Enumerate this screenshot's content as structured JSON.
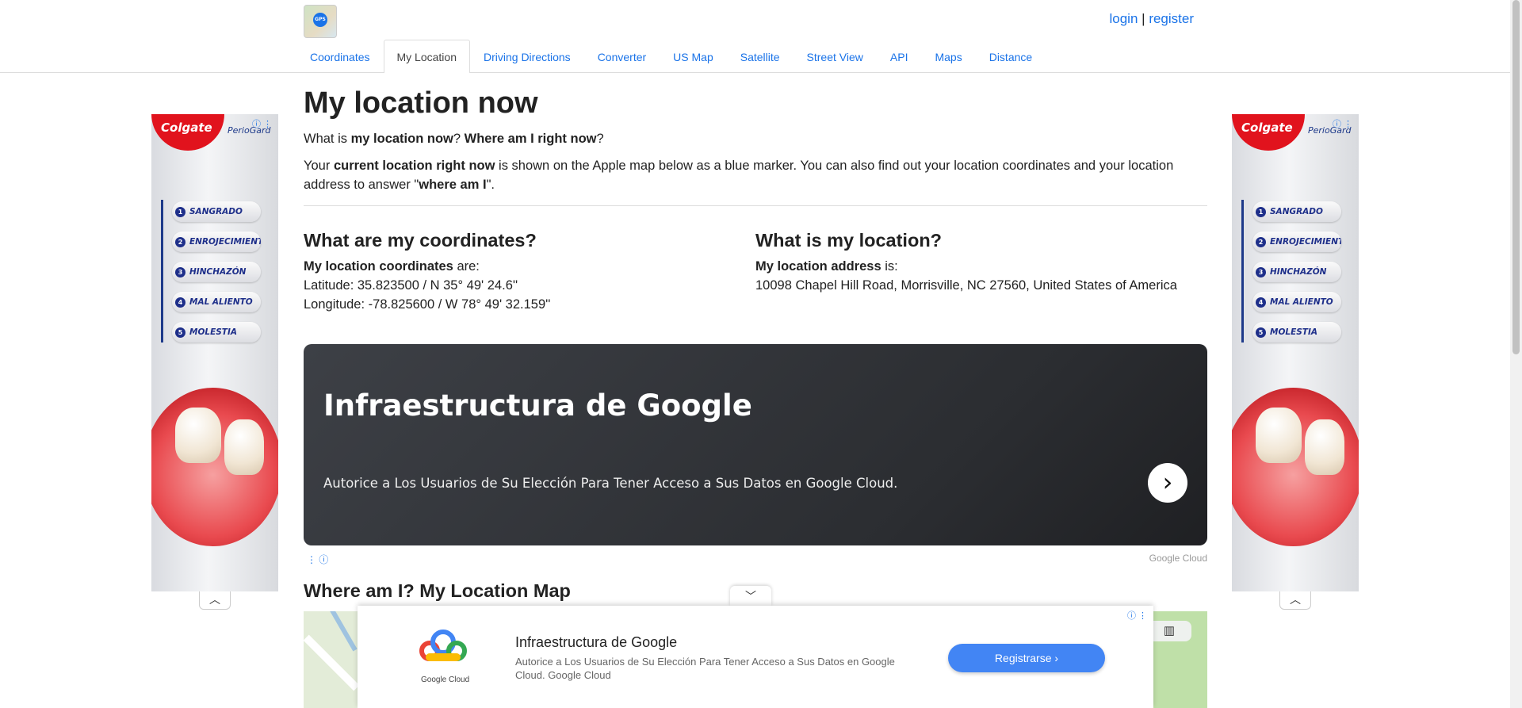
{
  "header": {
    "logo_text": "GPS",
    "login": "login",
    "separator": "|",
    "register": "register",
    "tabs": [
      {
        "label": "Coordinates"
      },
      {
        "label": "My Location"
      },
      {
        "label": "Driving Directions"
      },
      {
        "label": "Converter"
      },
      {
        "label": "US Map"
      },
      {
        "label": "Satellite"
      },
      {
        "label": "Street View"
      },
      {
        "label": "API"
      },
      {
        "label": "Maps"
      },
      {
        "label": "Distance"
      }
    ]
  },
  "side_ad": {
    "brand": "Colgate",
    "sub": "PerioGard",
    "items": [
      {
        "num": "1",
        "label": "SANGRADO"
      },
      {
        "num": "2",
        "label": "ENROJECIMIENTO"
      },
      {
        "num": "3",
        "label": "HINCHAZÓN"
      },
      {
        "num": "4",
        "label": "MAL ALIENTO"
      },
      {
        "num": "5",
        "label": "MOLESTIA"
      }
    ]
  },
  "main": {
    "title": "My location now",
    "q_pre": "What is ",
    "q_b1": "my location now",
    "q_mid": "? ",
    "q_b2": "Where am I right now",
    "q_end": "?",
    "intro_pre": "Your ",
    "intro_b": "current location right now",
    "intro_mid": " is shown on the Apple map below as a blue marker. You can also find out your location coordinates and your location address to answer \"",
    "intro_b2": "where am I",
    "intro_end": "\".",
    "coords": {
      "heading": "What are my coordinates?",
      "label_b": "My location coordinates",
      "label_end": " are:",
      "latitude": "Latitude: 35.823500 / N 35° 49' 24.6''",
      "longitude": "Longitude: -78.825600 / W 78° 49' 32.159''"
    },
    "location": {
      "heading": "What is my location?",
      "label_b": "My location address",
      "label_end": " is:",
      "address": "10098 Chapel Hill Road, Morrisville, NC 27560, United States of America"
    },
    "map_heading": "Where am I? My Location Map"
  },
  "big_ad": {
    "title": "Infraestructura de Google",
    "desc": "Autorice a Los Usuarios de Su Elección Para Tener Acceso a Sus Datos en Google Cloud.",
    "arrow": "›",
    "source": "Google Cloud"
  },
  "bottom_ad": {
    "logo_text": "Google Cloud",
    "title": "Infraestructura de Google",
    "desc": "Autorice a Los Usuarios de Su Elección Para Tener Acceso a Sus Datos en Google Cloud. Google Cloud",
    "cta": "Registrarse"
  },
  "colors": {
    "link": "#1a73e8",
    "ad_dark": "#2b2d31",
    "cta_blue": "#4285f4",
    "colgate_red": "#e1131d"
  }
}
